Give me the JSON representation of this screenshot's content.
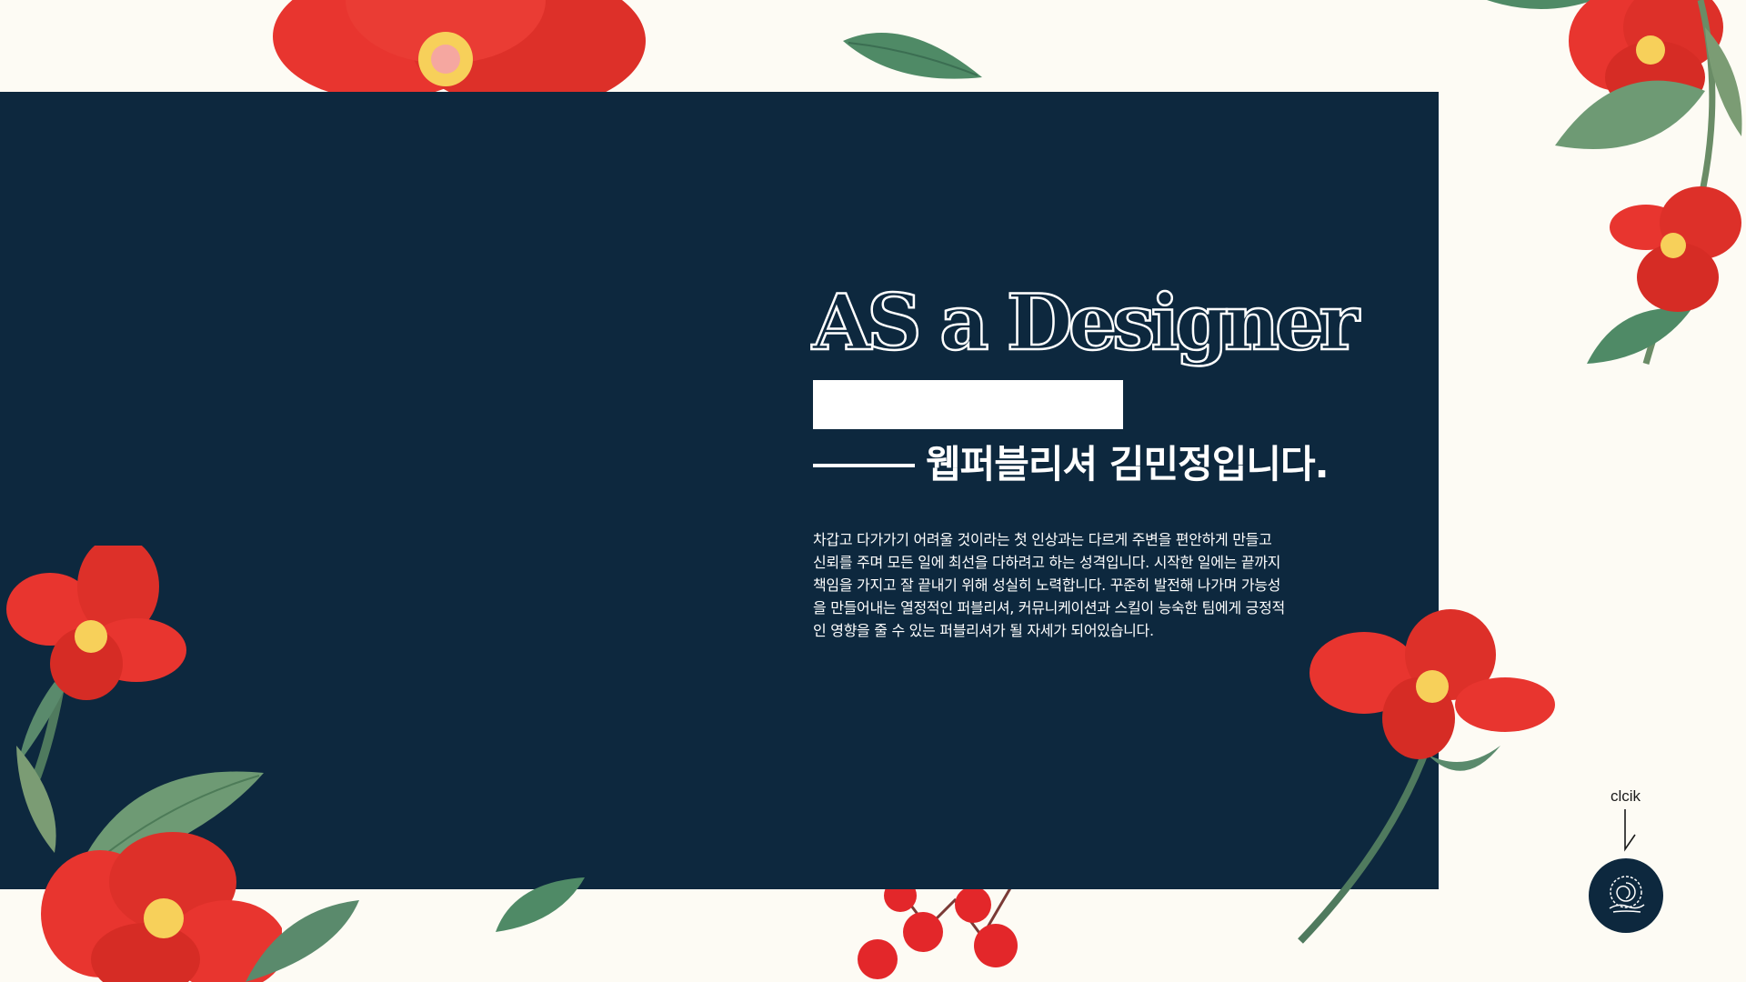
{
  "hero": {
    "headline": "AS a Designer",
    "name_heading": "웹퍼블리셔 김민정입니다.",
    "intro_lines": [
      "차갑고 다가가기 어려울 것이라는 첫 인상과는 다르게 주변을 편안하게  만들고",
      "신뢰를 주며 모든 일에 최선을 다하려고 하는 성격입니다. 시작한 일에는 끝까지",
      "책임을 가지고 잘 끝내기 위해 성실히 노력합니다. 꾸준히 발전해 나가며 가능성",
      "을 만들어내는 열정적인 퍼블리셔, 커뮤니케이션과 스킬이 능숙한 팀에게 긍정적",
      "인 영향을 줄 수 있는 퍼블리셔가 될 자세가 되어있습니다."
    ]
  },
  "click": {
    "label": "clcik",
    "icon": "swirl-hand-icon"
  },
  "colors": {
    "panel": "#0d283e",
    "background": "#fdfbf4",
    "flower": "#e8352f",
    "leaf": "#4f8a66"
  }
}
